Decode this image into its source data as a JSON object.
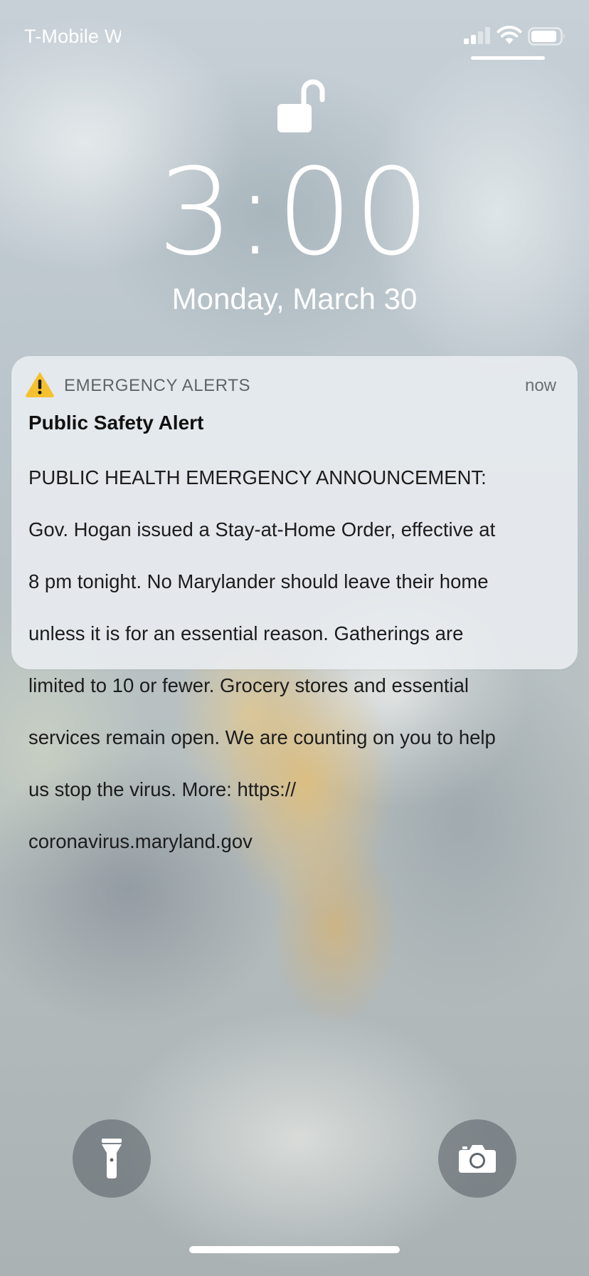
{
  "status_bar": {
    "carrier": "T-Mobile Wi-Fi",
    "signal_icon": "cellular-signal-icon",
    "wifi_icon": "wifi-icon",
    "battery_icon": "battery-icon"
  },
  "lock_screen": {
    "lock_icon": "unlocked-padlock-icon",
    "time": "3:00",
    "date": "Monday, March 30"
  },
  "notification": {
    "icon": "warning-triangle-icon",
    "app_name": "EMERGENCY ALERTS",
    "time": "now",
    "title": "Public Safety Alert",
    "body_lines": [
      "PUBLIC HEALTH EMERGENCY ANNOUNCEMENT:",
      "Gov. Hogan issued a Stay-at-Home Order, effective at",
      "8 pm tonight. No Marylander should leave their home",
      "unless it is for an essential reason. Gatherings are",
      "limited to 10 or fewer. Grocery stores and essential",
      "services remain open. We are counting on you to help",
      "us stop the virus. More: https://",
      "coronavirus.maryland.gov"
    ]
  },
  "shortcuts": {
    "flashlight_icon": "flashlight-icon",
    "camera_icon": "camera-icon"
  },
  "colors": {
    "alert_yellow": "#F5C12E",
    "notification_bg": "#ECF0F3",
    "text_primary": "#111111",
    "text_secondary": "#5F6467"
  }
}
